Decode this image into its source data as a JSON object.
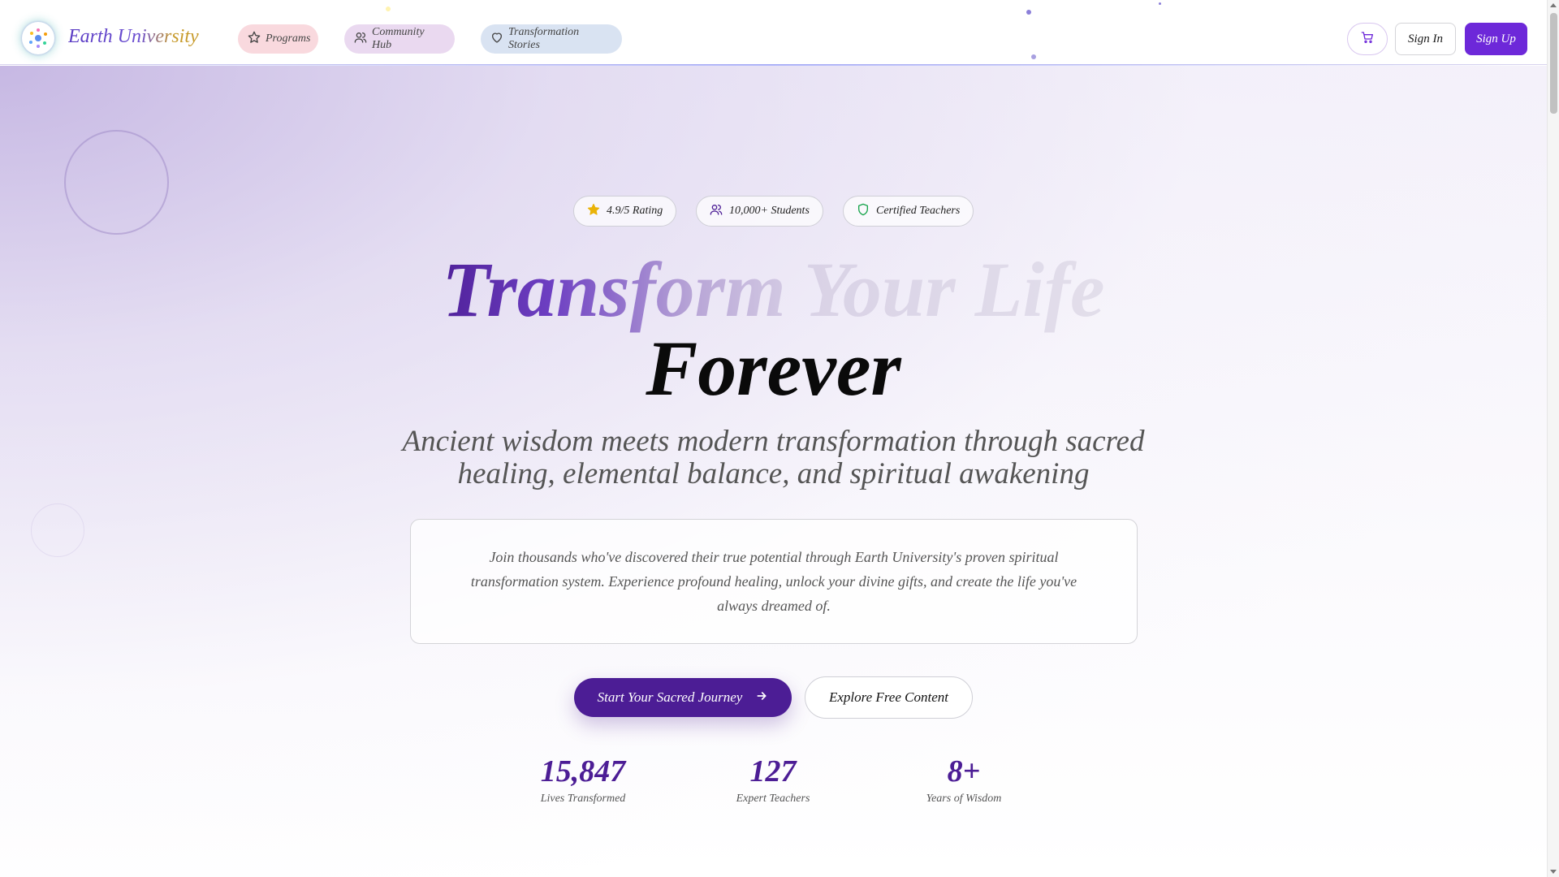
{
  "header": {
    "brand": "Earth University",
    "nav": [
      {
        "label": "Programs",
        "icon": "star-icon"
      },
      {
        "label": "Community Hub",
        "icon": "users-icon"
      },
      {
        "label": "Transformation Stories",
        "icon": "heart-icon"
      }
    ],
    "cart_icon": "cart-icon",
    "sign_in": "Sign In",
    "sign_up": "Sign Up"
  },
  "hero": {
    "badges": [
      {
        "label": "4.9/5 Rating",
        "icon": "star-filled-icon"
      },
      {
        "label": "10,000+ Students",
        "icon": "users-icon"
      },
      {
        "label": "Certified Teachers",
        "icon": "shield-icon"
      }
    ],
    "title_line1": "Transform Your Life",
    "title_line2": "Forever",
    "subtitle": "Ancient wisdom meets modern transformation through sacred healing, elemental balance, and spiritual awakening",
    "description": "Join thousands who've discovered their true potential through Earth University's proven spiritual transformation system. Experience profound healing, unlock your divine gifts, and create the life you've always dreamed of.",
    "cta_primary": "Start Your Sacred Journey",
    "cta_secondary": "Explore Free Content",
    "stats": [
      {
        "value": "15,847",
        "label": "Lives Transformed"
      },
      {
        "value": "127",
        "label": "Expert Teachers"
      },
      {
        "value": "8+",
        "label": "Years of Wisdom"
      }
    ]
  },
  "colors": {
    "primary": "#4c1d95",
    "accent": "#6d28d9",
    "gold": "#c79a2a",
    "rating_star": "#eab308",
    "shield": "#16a34a"
  }
}
